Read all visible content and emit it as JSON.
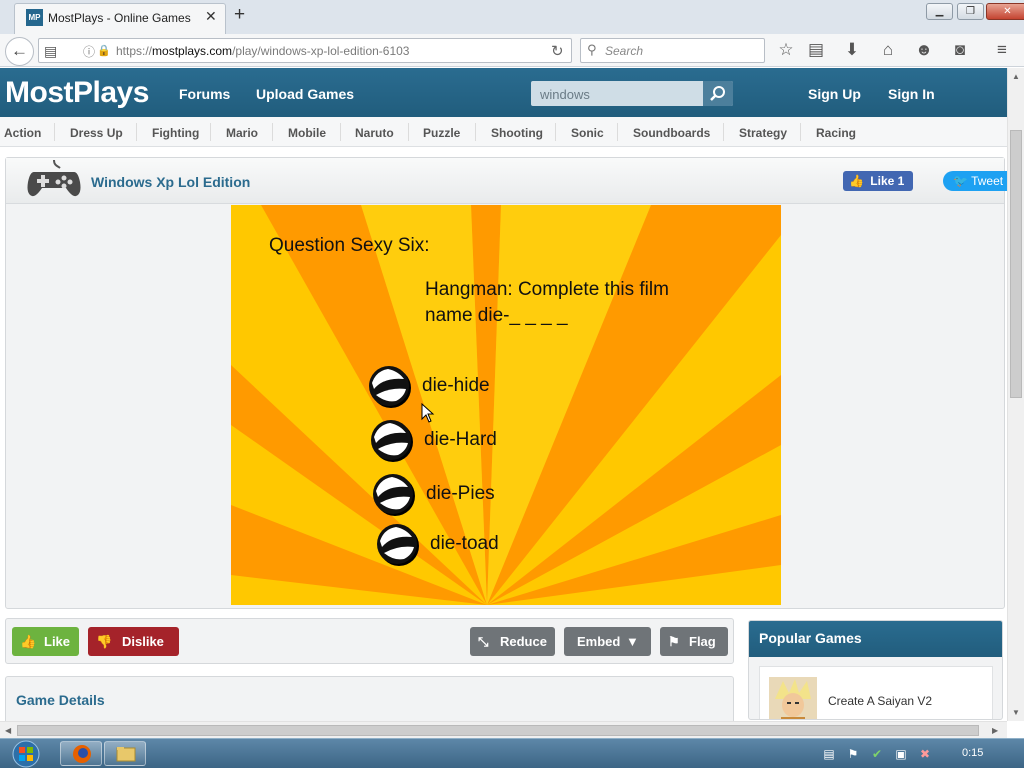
{
  "browser": {
    "tab_title": "MostPlays - Online Games",
    "favicon_text": "MP",
    "url_prefix": "https://",
    "url_host": "mostplays.com",
    "url_path": "/play/windows-xp-lol-edition-6103",
    "search_placeholder": "Search"
  },
  "site": {
    "logo": "MostPlays",
    "nav": [
      "Forums",
      "Upload Games"
    ],
    "search_value": "windows",
    "auth": [
      "Sign Up",
      "Sign In"
    ],
    "categories": [
      "Action",
      "Dress Up",
      "Fighting",
      "Mario",
      "Mobile",
      "Naruto",
      "Puzzle",
      "Shooting",
      "Sonic",
      "Soundboards",
      "Strategy",
      "Racing"
    ]
  },
  "game": {
    "title": "Windows Xp Lol Edition",
    "fb_like": "Like 1",
    "tweet": "Tweet",
    "question_title": "Question Sexy Six:",
    "question_text": "Hangman: Complete this film name die-_ _ _ _",
    "answers": [
      "die-hide",
      "die-Hard",
      "die-Pies",
      "die-toad"
    ]
  },
  "actions": {
    "like": "Like",
    "dislike": "Dislike",
    "reduce": "Reduce",
    "embed": "Embed",
    "flag": "Flag"
  },
  "details": {
    "title": "Game Details"
  },
  "popular": {
    "title": "Popular Games",
    "items": [
      {
        "name": "Create A Saiyan V2"
      }
    ]
  },
  "taskbar": {
    "clock": "0:15"
  },
  "colors": {
    "header_blue": "#256588",
    "title_blue": "#2b6b8e",
    "like_green": "#6db33f",
    "dislike_red": "#a5232a",
    "game_yellow": "#ffc800",
    "game_orange": "#ff9a00"
  }
}
